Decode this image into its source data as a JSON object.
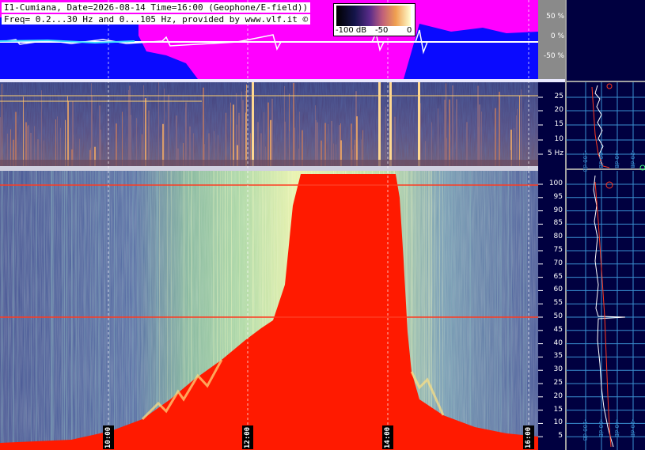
{
  "header": {
    "line1": "I1-Cumiana, Date=2026-08-14 Time=16:00 (Geophone/E-field))",
    "line2": "Freq= 0.2...30 Hz and 0...105 Hz, provided by www.vlf.it ©"
  },
  "legend": {
    "min_label": "-100 dB",
    "mid_label": "-50",
    "max_label": "0"
  },
  "waveform_scale": [
    "50 %",
    "0 %",
    "-50 %"
  ],
  "elf_scale": {
    "ticks": [
      "25",
      "20",
      "15",
      "10",
      "5 Hz"
    ]
  },
  "vlf_scale": {
    "ticks": [
      "100",
      "95",
      "90",
      "85",
      "80",
      "75",
      "70",
      "65",
      "60",
      "55",
      "50",
      "45",
      "40",
      "35",
      "30",
      "25",
      "20",
      "15",
      "10",
      "5"
    ]
  },
  "time_labels": [
    "10:00",
    "12:00",
    "14:00",
    "16:00"
  ],
  "spectrum_db_labels": [
    "-100 dB",
    "-60 dB",
    "-40 dB",
    "-20 dB"
  ],
  "colors": {
    "waveform_blue": "#0a0aff",
    "waveform_magenta": "#ff00ff",
    "spectrum_bg": "#000040",
    "grid": "#3a8fd0",
    "red_saturation": "#ff1a00",
    "mains_line": "#ff3a20"
  }
}
